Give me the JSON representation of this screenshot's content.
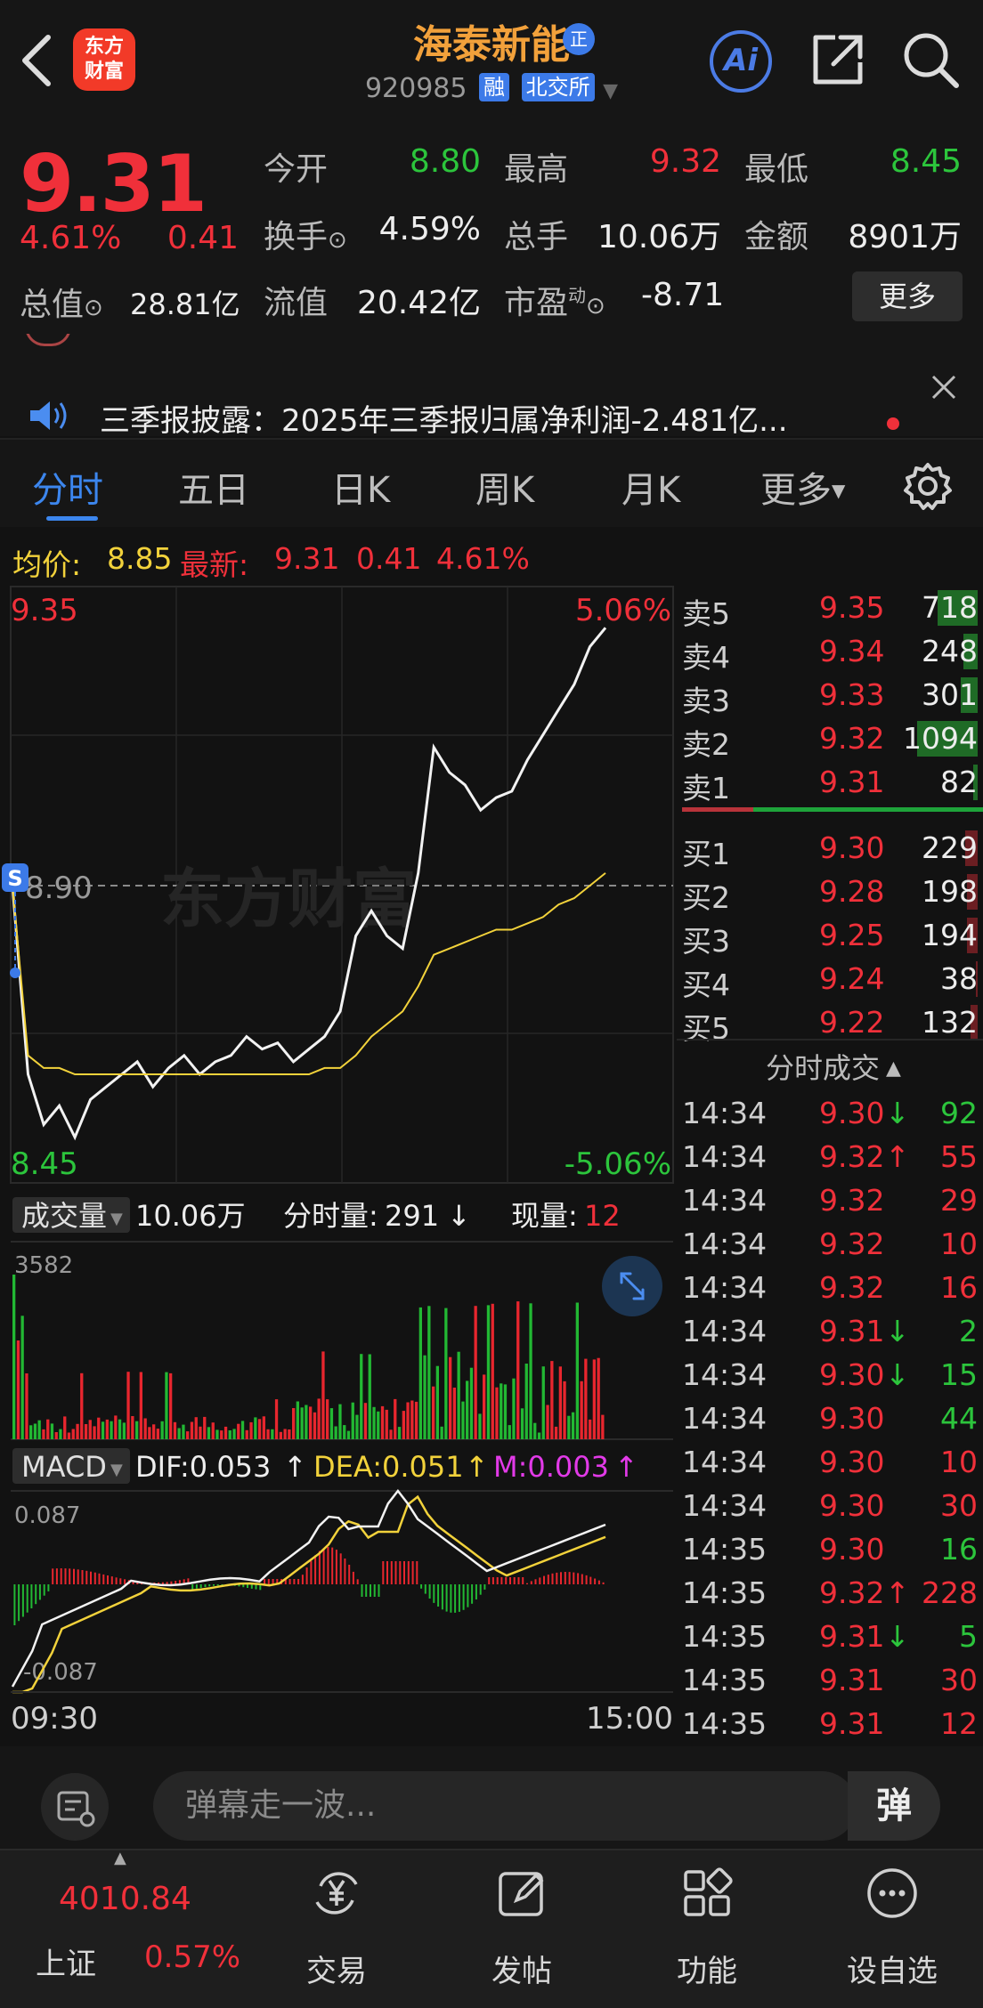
{
  "header": {
    "stock_name": "海泰新能",
    "name_badge": "正",
    "stock_code": "920985",
    "tag_margin": "融",
    "tag_exchange": "北交所",
    "logo_line1": "东方",
    "logo_line2": "财富",
    "ai_label": "Ai"
  },
  "quote": {
    "price": "9.31",
    "change_pct": "4.61%",
    "change_amt": "0.41",
    "open_label": "今开",
    "open_value": "8.80",
    "high_label": "最高",
    "high_value": "9.32",
    "low_label": "最低",
    "low_value": "8.45",
    "turnover_label": "换手",
    "turnover_value": "4.59%",
    "volume_label": "总手",
    "volume_value": "10.06万",
    "amount_label": "金额",
    "amount_value": "8901万",
    "mktcap_label": "总值",
    "mktcap_value": "28.81亿",
    "float_label": "流值",
    "float_value": "20.42亿",
    "pe_label": "市盈",
    "pe_sup": "动",
    "pe_value": "-8.71",
    "more_label": "更多"
  },
  "news": {
    "text": "三季报披露：2025年三季报归属净利润-2.481亿..."
  },
  "tabs": [
    {
      "label": "分时"
    },
    {
      "label": "五日"
    },
    {
      "label": "日K"
    },
    {
      "label": "周K"
    },
    {
      "label": "月K"
    },
    {
      "label": "更多"
    }
  ],
  "intraday": {
    "avg_label": "均价:",
    "avg_value": "8.85",
    "latest_label": "最新:",
    "latest_value": "9.31",
    "latest_chg": "0.41",
    "latest_pct": "4.61%",
    "y_top": "9.35",
    "y_mid": "8.90",
    "y_bottom": "8.45",
    "pct_top": "5.06%",
    "pct_bottom": "-5.06%",
    "watermark": "东方财富",
    "s_marker": "S",
    "vol_label": "成交量",
    "vol_total": "10.06万",
    "vol_minute_label": "分时量:",
    "vol_minute_value": "291",
    "vol_now_label": "现量:",
    "vol_now_value": "12",
    "vol_max": "3582",
    "macd_label": "MACD",
    "dif": "DIF:0.053",
    "dea": "DEA:0.051",
    "m": "M:0.003",
    "macd_top": "0.087",
    "macd_bottom": "-0.087",
    "time_start": "09:30",
    "time_end": "15:00"
  },
  "chart_data": {
    "type": "line",
    "x_range": [
      "09:30",
      "15:00"
    ],
    "ylim": [
      8.45,
      9.35
    ],
    "prev_close": 8.9,
    "series": [
      {
        "name": "最新",
        "values": [
          8.9,
          8.6,
          8.52,
          8.55,
          8.5,
          8.56,
          8.58,
          8.6,
          8.62,
          8.58,
          8.61,
          8.63,
          8.6,
          8.62,
          8.63,
          8.66,
          8.64,
          8.65,
          8.62,
          8.64,
          8.66,
          8.7,
          8.82,
          8.86,
          8.82,
          8.8,
          8.92,
          9.12,
          9.08,
          9.06,
          9.02,
          9.04,
          9.05,
          9.1,
          9.14,
          9.18,
          9.22,
          9.28,
          9.31
        ]
      },
      {
        "name": "均价",
        "values": [
          8.9,
          8.63,
          8.61,
          8.61,
          8.6,
          8.6,
          8.6,
          8.6,
          8.6,
          8.6,
          8.6,
          8.6,
          8.6,
          8.6,
          8.6,
          8.6,
          8.6,
          8.6,
          8.6,
          8.6,
          8.61,
          8.61,
          8.63,
          8.66,
          8.68,
          8.7,
          8.74,
          8.79,
          8.8,
          8.81,
          8.82,
          8.83,
          8.83,
          8.84,
          8.85,
          8.87,
          8.88,
          8.9,
          8.92
        ]
      }
    ]
  },
  "orderbook": {
    "asks": [
      {
        "label": "卖5",
        "price": "9.35",
        "qty": "718",
        "bar": 0.66
      },
      {
        "label": "卖4",
        "price": "9.34",
        "qty": "248",
        "bar": 0.23
      },
      {
        "label": "卖3",
        "price": "9.33",
        "qty": "301",
        "bar": 0.28
      },
      {
        "label": "卖2",
        "price": "9.32",
        "qty": "1094",
        "bar": 1.0
      },
      {
        "label": "卖1",
        "price": "9.31",
        "qty": "82",
        "bar": 0.07
      }
    ],
    "bids": [
      {
        "label": "买1",
        "price": "9.30",
        "qty": "229",
        "bar": 0.21
      },
      {
        "label": "买2",
        "price": "9.28",
        "qty": "198",
        "bar": 0.18
      },
      {
        "label": "买3",
        "price": "9.25",
        "qty": "194",
        "bar": 0.18
      },
      {
        "label": "买4",
        "price": "9.24",
        "qty": "38",
        "bar": 0.03
      },
      {
        "label": "买5",
        "price": "9.22",
        "qty": "132",
        "bar": 0.12
      }
    ],
    "ticks_title": "分时成交",
    "ticks": [
      {
        "time": "14:34",
        "price": "9.30",
        "dir": "↓",
        "qty": "92",
        "color": "#2cc53c"
      },
      {
        "time": "14:34",
        "price": "9.32",
        "dir": "↑",
        "qty": "55",
        "color": "#f0303a"
      },
      {
        "time": "14:34",
        "price": "9.32",
        "dir": "",
        "qty": "29",
        "color": "#f0303a"
      },
      {
        "time": "14:34",
        "price": "9.32",
        "dir": "",
        "qty": "10",
        "color": "#f0303a"
      },
      {
        "time": "14:34",
        "price": "9.32",
        "dir": "",
        "qty": "16",
        "color": "#f0303a"
      },
      {
        "time": "14:34",
        "price": "9.31",
        "dir": "↓",
        "qty": "2",
        "color": "#2cc53c"
      },
      {
        "time": "14:34",
        "price": "9.30",
        "dir": "↓",
        "qty": "15",
        "color": "#2cc53c"
      },
      {
        "time": "14:34",
        "price": "9.30",
        "dir": "",
        "qty": "44",
        "color": "#2cc53c"
      },
      {
        "time": "14:34",
        "price": "9.30",
        "dir": "",
        "qty": "10",
        "color": "#f0303a"
      },
      {
        "time": "14:34",
        "price": "9.30",
        "dir": "",
        "qty": "30",
        "color": "#f0303a"
      },
      {
        "time": "14:35",
        "price": "9.30",
        "dir": "",
        "qty": "16",
        "color": "#2cc53c"
      },
      {
        "time": "14:35",
        "price": "9.32",
        "dir": "↑",
        "qty": "228",
        "color": "#f0303a"
      },
      {
        "time": "14:35",
        "price": "9.31",
        "dir": "↓",
        "qty": "5",
        "color": "#2cc53c"
      },
      {
        "time": "14:35",
        "price": "9.31",
        "dir": "",
        "qty": "30",
        "color": "#f0303a"
      },
      {
        "time": "14:35",
        "price": "9.31",
        "dir": "",
        "qty": "12",
        "color": "#f0303a"
      }
    ]
  },
  "comment": {
    "placeholder": "弹幕走一波...",
    "danmu_label": "弹"
  },
  "bottom_nav": {
    "index_value": "4010.84",
    "index_name": "上证",
    "index_pct": "0.57%",
    "items": [
      {
        "label": "交易"
      },
      {
        "label": "发帖"
      },
      {
        "label": "功能"
      },
      {
        "label": "设自选"
      }
    ]
  }
}
